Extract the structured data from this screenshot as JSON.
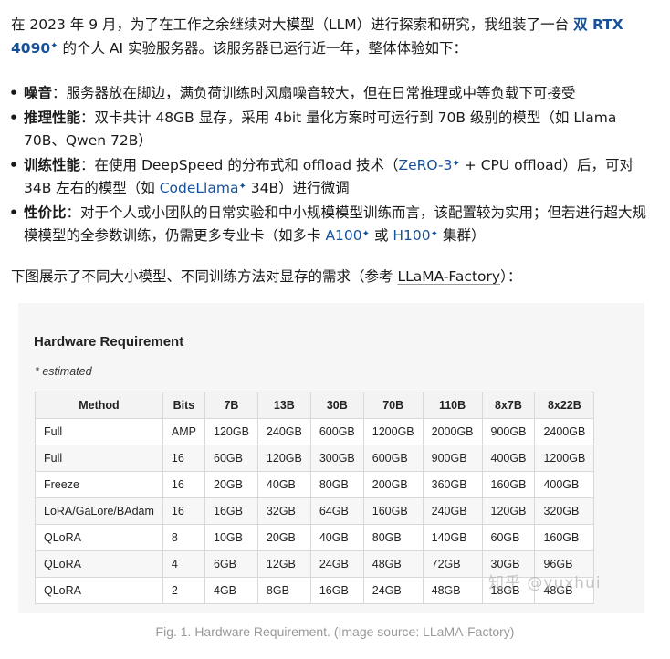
{
  "intro": {
    "text1": "在 2023 年 9 月，为了在工作之余继续对大模型（LLM）进行探索和研究，我组装了一台 ",
    "gpu": "双 RTX 4090",
    "sup": "✦",
    "text2": " 的个人 AI 实验服务器。该服务器已运行近一年，整体体验如下："
  },
  "bullets": [
    {
      "title": "噪音",
      "body": "：服务器放在脚边，满负荷训练时风扇噪音较大，但在日常推理或中等负载下可接受"
    },
    {
      "title": "推理性能",
      "body": "：双卡共计 48GB 显存，采用 4bit 量化方案时可运行到 70B 级别的模型（如 Llama 70B、Qwen 72B）"
    },
    {
      "title": "训练性能",
      "pre": "：在使用 ",
      "link1": "DeepSpeed",
      "mid1": " 的分布式和 offload 技术（",
      "link2": "ZeRO-3",
      "mid2": " + CPU offload）后，可对 34B 左右的模型（如 ",
      "link3": "CodeLlama",
      "mid3": " 34B）进行微调"
    },
    {
      "title": "性价比",
      "pre": "：对于个人或小团队的日常实验和中小规模模型训练而言，该配置较为实用；但若进行超大规模模型的全参数训练，仍需更多专业卡（如多卡 ",
      "link1": "A100",
      "mid1": " 或 ",
      "link2": "H100",
      "mid2": " 集群）"
    }
  ],
  "ref": {
    "pre": "下图展示了不同大小模型、不同训练方法对显存的需求（参考 ",
    "link": "LLaMA-Factory",
    "post": "）："
  },
  "figure": {
    "title": "Hardware Requirement",
    "note": "* estimated",
    "watermark": "知乎 @yuxhui",
    "caption": "Fig. 1. Hardware Requirement. (Image source: LLaMA-Factory)",
    "headers": [
      "Method",
      "Bits",
      "7B",
      "13B",
      "30B",
      "70B",
      "110B",
      "8x7B",
      "8x22B"
    ],
    "rows": [
      [
        "Full",
        "AMP",
        "120GB",
        "240GB",
        "600GB",
        "1200GB",
        "2000GB",
        "900GB",
        "2400GB"
      ],
      [
        "Full",
        "16",
        "60GB",
        "120GB",
        "300GB",
        "600GB",
        "900GB",
        "400GB",
        "1200GB"
      ],
      [
        "Freeze",
        "16",
        "20GB",
        "40GB",
        "80GB",
        "200GB",
        "360GB",
        "160GB",
        "400GB"
      ],
      [
        "LoRA/GaLore/BAdam",
        "16",
        "16GB",
        "32GB",
        "64GB",
        "160GB",
        "240GB",
        "120GB",
        "320GB"
      ],
      [
        "QLoRA",
        "8",
        "10GB",
        "20GB",
        "40GB",
        "80GB",
        "140GB",
        "60GB",
        "160GB"
      ],
      [
        "QLoRA",
        "4",
        "6GB",
        "12GB",
        "24GB",
        "48GB",
        "72GB",
        "30GB",
        "96GB"
      ],
      [
        "QLoRA",
        "2",
        "4GB",
        "8GB",
        "16GB",
        "24GB",
        "48GB",
        "18GB",
        "48GB"
      ]
    ]
  }
}
